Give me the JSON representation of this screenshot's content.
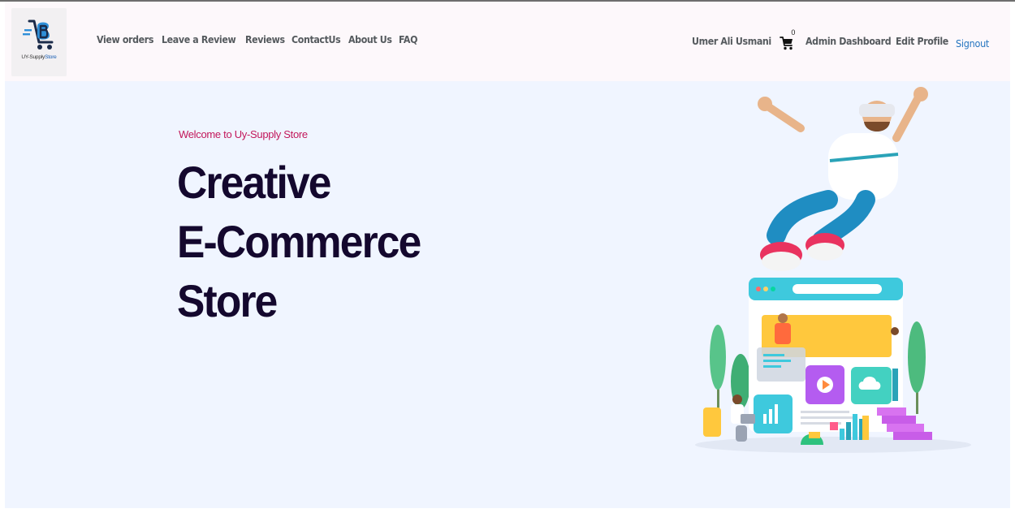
{
  "brand": {
    "logo_text_a": "UY-Supply",
    "logo_text_b": "Store"
  },
  "nav": {
    "left": [
      "View orders",
      "Leave a Review",
      "Reviews",
      "ContactUs",
      "About Us",
      "FAQ"
    ],
    "user_name": "Umer Ali Usmani",
    "cart_count": "0",
    "admin_dashboard": "Admin Dashboard",
    "edit_profile": "Edit Profile",
    "signout": "Signout"
  },
  "hero": {
    "welcome": "Welcome to Uy-Supply Store",
    "headline_lines": [
      "Creative",
      "E-Commerce",
      "Store"
    ]
  },
  "colors": {
    "accent_pink": "#c2185b",
    "headline": "#14082e",
    "link_blue": "#2676c0",
    "nav_text": "#555a5e",
    "hero_bg": "#f0f5ff"
  }
}
